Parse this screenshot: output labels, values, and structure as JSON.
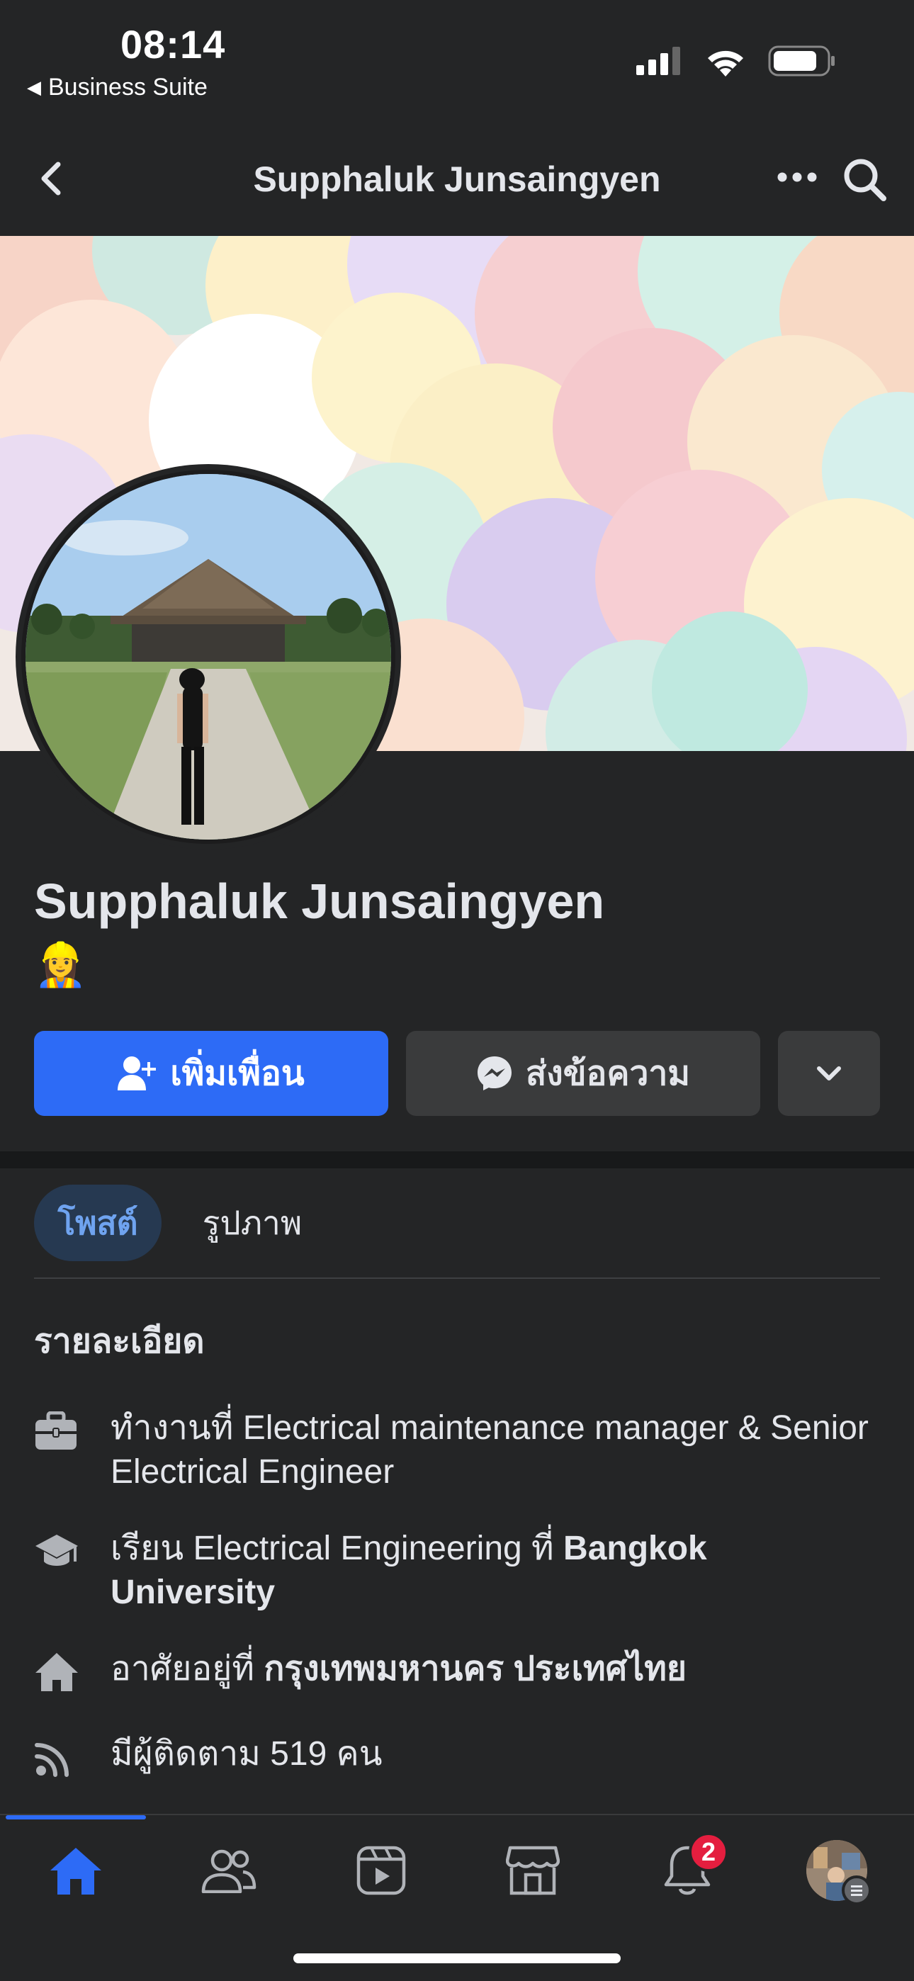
{
  "status_bar": {
    "time": "08:14",
    "back_app": "Business Suite"
  },
  "header": {
    "title": "Supphaluk Junsaingyen"
  },
  "profile": {
    "name": "Supphaluk Junsaingyen",
    "emoji": "👷‍♀️"
  },
  "actions": {
    "add_friend": "เพิ่มเพื่อน",
    "message": "ส่งข้อความ"
  },
  "tabs": [
    {
      "label": "โพสต์",
      "active": true
    },
    {
      "label": "รูปภาพ",
      "active": false
    }
  ],
  "details": {
    "title": "รายละเอียด",
    "work_prefix": "ทำงานที่ ",
    "work": "Electrical maintenance manager & Senior Electrical Engineer",
    "study_prefix": "เรียน ",
    "study_field": "Electrical Engineering",
    "study_mid": " ที่ ",
    "study_school": "Bangkok University",
    "lives_prefix": "อาศัยอยู่ที่ ",
    "lives": "กรุงเทพมหานคร ประเทศไทย",
    "followers_prefix": "มีผู้ติดตาม ",
    "followers_count": "519",
    "followers_suffix": " คน"
  },
  "bottom_nav": {
    "notifications_badge": "2",
    "items": [
      "home-icon",
      "friends-icon",
      "video-icon",
      "marketplace-icon",
      "notifications-icon",
      "menu-avatar"
    ]
  },
  "colors": {
    "accent": "#2d6bf6",
    "background": "#242526",
    "badge": "#e41e3f"
  }
}
